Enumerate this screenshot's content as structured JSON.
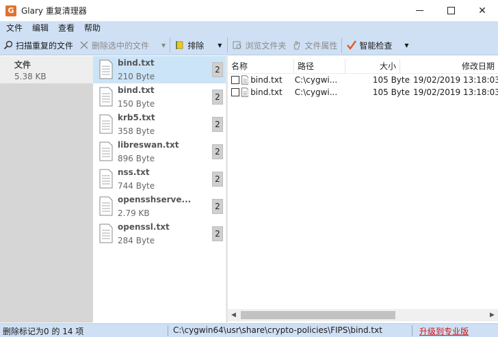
{
  "window": {
    "title": "Glary 重复清理器",
    "app_icon_glyph": "G",
    "controls": {
      "minimize": "minimize-icon",
      "maximize": "maximize-icon",
      "close": "✕"
    }
  },
  "menu": [
    "文件",
    "编辑",
    "查看",
    "帮助"
  ],
  "toolbar": {
    "scan_label": "扫描重复的文件",
    "delete_label": "删除选中的文件",
    "exclude_label": "排除",
    "browse_label": "浏览文件夹",
    "properties_label": "文件属性",
    "smart_label": "智能检查"
  },
  "folder": {
    "name": "文件",
    "size": "5.38 KB"
  },
  "groups": [
    {
      "name": "bind.txt",
      "size": "210 Byte",
      "count": "2",
      "selected": true
    },
    {
      "name": "bind.txt",
      "size": "150 Byte",
      "count": "2"
    },
    {
      "name": "krb5.txt",
      "size": "358 Byte",
      "count": "2"
    },
    {
      "name": "libreswan.txt",
      "size": "896 Byte",
      "count": "2"
    },
    {
      "name": "nss.txt",
      "size": "744 Byte",
      "count": "2"
    },
    {
      "name": "opensshserve...",
      "size": "2.79 KB",
      "count": "2"
    },
    {
      "name": "openssl.txt",
      "size": "284 Byte",
      "count": "2"
    }
  ],
  "table": {
    "columns": {
      "name": "名称",
      "path": "路径",
      "size": "大小",
      "date": "修改日期"
    },
    "rows": [
      {
        "name": "bind.txt",
        "path": "C:\\cygwi...",
        "size": "105 Byte",
        "date": "19/02/2019 13:18:03"
      },
      {
        "name": "bind.txt",
        "path": "C:\\cygwi...",
        "size": "105 Byte",
        "date": "19/02/2019 13:18:03"
      }
    ]
  },
  "status": {
    "marked": "删除标记为0 的 14 项",
    "path": "C:\\cygwin64\\usr\\share\\crypto-policies\\FIPS\\bind.txt",
    "upgrade": "升级到专业版"
  },
  "colors": {
    "chrome": "#cfe0f4",
    "selection": "#cce4f7",
    "upgrade_link": "#d01414"
  }
}
